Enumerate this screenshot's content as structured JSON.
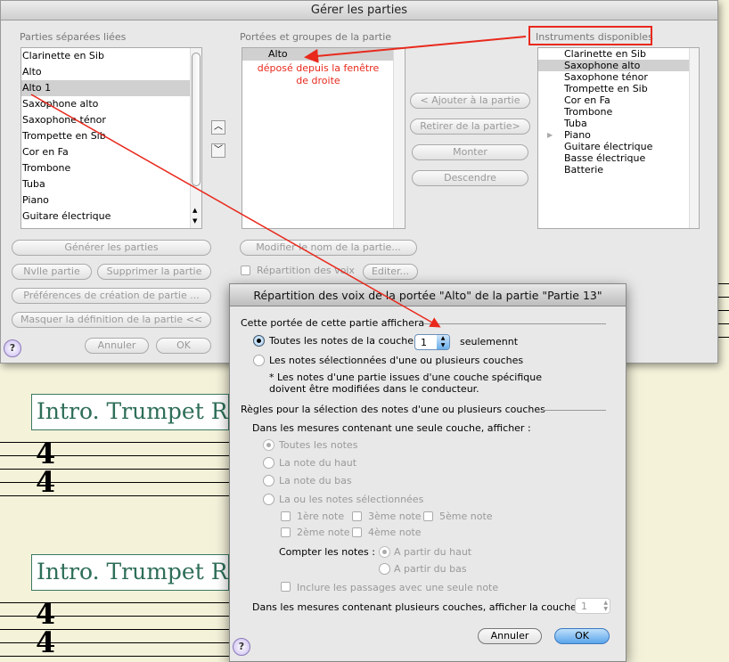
{
  "window": {
    "title": "Gérer les parties"
  },
  "linked_parts": {
    "label": "Parties séparées liées",
    "items": [
      "Clarinette en Sib",
      "Alto",
      "Alto 1",
      "Saxophone alto",
      "Saxophone ténor",
      "Trompette en Sib",
      "Cor en Fa",
      "Trombone",
      "Tuba",
      "Piano",
      "Guitare électrique"
    ],
    "selected": "Alto 1"
  },
  "staves": {
    "label": "Portées et groupes de la partie",
    "items": [
      "Alto"
    ],
    "annotation_line1": "déposé depuis la fenêtre",
    "annotation_line2": "de droite"
  },
  "middle_buttons": {
    "add": "< Ajouter à la partie",
    "remove": "Retirer de la partie>",
    "up": "Monter",
    "down": "Descendre"
  },
  "instruments": {
    "label": "Instruments disponibles",
    "items": [
      "Clarinette en Sib",
      "Saxophone alto",
      "Saxophone ténor",
      "Trompette en Sib",
      "Cor en Fa",
      "Trombone",
      "Tuba",
      "Piano",
      "Guitare électrique",
      "Basse électrique",
      "Batterie"
    ],
    "selected": "Saxophone alto",
    "expandable": "Piano"
  },
  "left_buttons": {
    "generate": "Générer les parties",
    "new": "Nvlle partie",
    "delete": "Supprimer la partie",
    "prefs": "Préférences de création de partie ...",
    "hide": "Masquer la définition de la partie <<",
    "cancel": "Annuler",
    "ok": "OK"
  },
  "part_buttons": {
    "rename": "Modifier le nom de la partie...",
    "voicing_label": "Répartition des voix",
    "edit": "Editer..."
  },
  "help": "?",
  "score": {
    "title": "Intro. Trumpet Ru",
    "time_sig_top": "4",
    "time_sig_bottom": "4"
  },
  "dialog": {
    "title": "Répartition des voix de la portée \"Alto\" de la partie \"Partie 13\"",
    "section1": "Cette portée de cette partie affichera",
    "opt_all": "Toutes les notes de la couche",
    "layer_value": "1",
    "opt_all_suffix": "seulemennt",
    "opt_selected": "Les notes sélectionnées d'une ou plusieurs couches",
    "note1": "* Les notes d'une partie issues d'une couche spécifique",
    "note2": "doivent être modifiées dans le conducteur.",
    "section2": "Règles pour la sélection des notes d'une ou plusieurs couches",
    "single_layer_label": "Dans les mesures contenant une seule couche, afficher :",
    "r_all": "Toutes les notes",
    "r_top": "La note du haut",
    "r_bottom": "La note du bas",
    "r_sel": "La ou les notes sélectionnées",
    "n1": "1ère note",
    "n3": "3ème note",
    "n5": "5ème note",
    "n2": "2ème note",
    "n4": "4ème note",
    "count_label": "Compter les notes :",
    "count_top": "A partir du haut",
    "count_bottom": "A partir du bas",
    "include": "Inclure les passages avec une seule note",
    "multi_label": "Dans les mesures contenant plusieurs couches, afficher la couche :",
    "multi_value": "1",
    "cancel": "Annuler",
    "ok": "OK"
  },
  "colors": {
    "annotation": "#e8291c",
    "accent": "#5aa4ea",
    "score_text": "#2e6e58"
  }
}
